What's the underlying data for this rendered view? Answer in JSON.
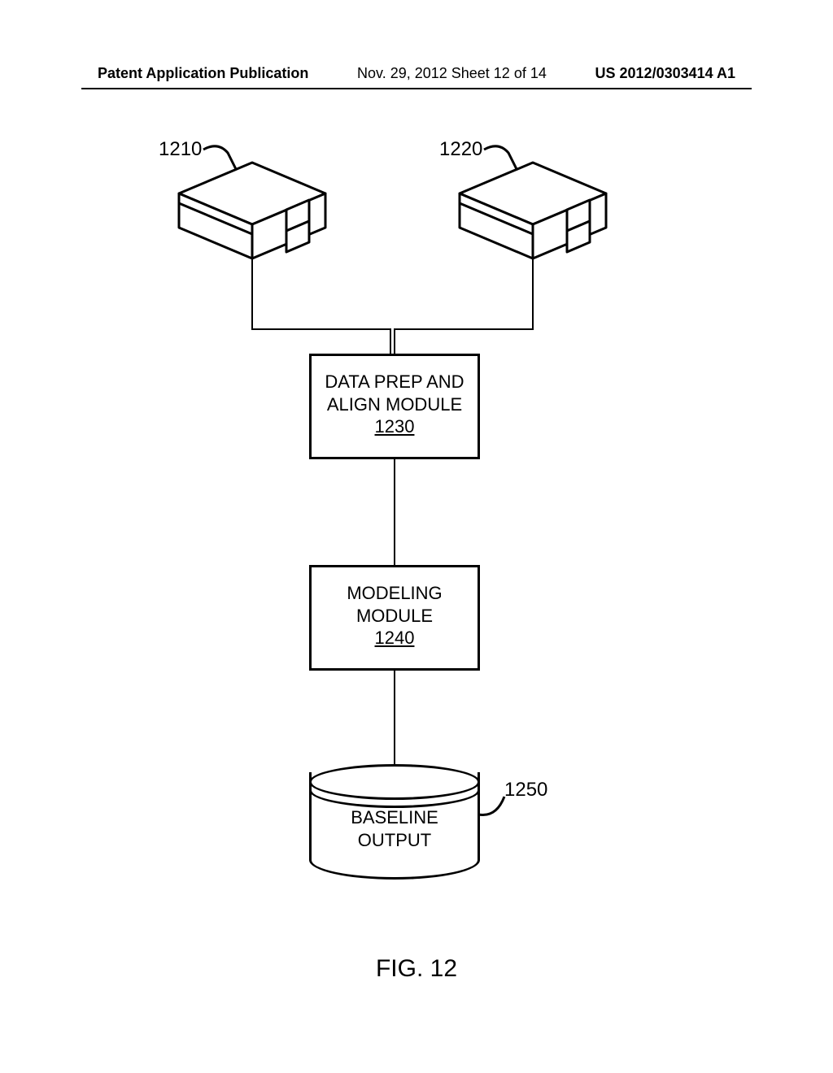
{
  "header": {
    "left": "Patent Application Publication",
    "mid": "Nov. 29, 2012  Sheet 12 of 14",
    "right": "US 2012/0303414 A1"
  },
  "refs": {
    "box_left": "1210",
    "box_right": "1220",
    "data_prep": {
      "line1": "DATA PREP AND",
      "line2": "ALIGN MODULE",
      "num": "1230"
    },
    "modeling": {
      "line1": "MODELING",
      "line2": "MODULE",
      "num": "1240"
    },
    "cylinder": {
      "line1": "BASELINE",
      "line2": "OUTPUT",
      "ref": "1250"
    }
  },
  "caption": "FIG. 12"
}
